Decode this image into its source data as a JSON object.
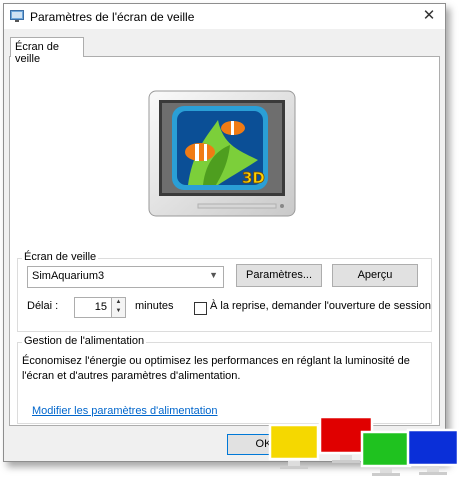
{
  "window": {
    "title": "Paramètres de l'écran de veille",
    "close_glyph": "✕"
  },
  "tabs": [
    {
      "label": "Écran de veille"
    }
  ],
  "preview": {
    "badge": "3D"
  },
  "screensaver_group": {
    "title": "Écran de veille",
    "selected": "SimAquarium3",
    "settings_button": "Paramètres...",
    "preview_button": "Aperçu",
    "delay_label": "Délai :",
    "delay_value": "15",
    "delay_unit": "minutes",
    "resume_checkbox_label": "À la reprise, demander l'ouverture de session",
    "resume_checked": false
  },
  "power_group": {
    "title": "Gestion de l'alimentation",
    "description_line1": "Économisez l'énergie ou optimisez les performances en réglant la luminosité de",
    "description_line2": "l'écran et d'autres paramètres d'alimentation.",
    "link": "Modifier les paramètres d'alimentation"
  },
  "footer": {
    "ok_button": "OK"
  },
  "colors": {
    "yellow": "#f5d800",
    "red": "#e00000",
    "green": "#1fc21f",
    "blue": "#0a2fd8"
  }
}
